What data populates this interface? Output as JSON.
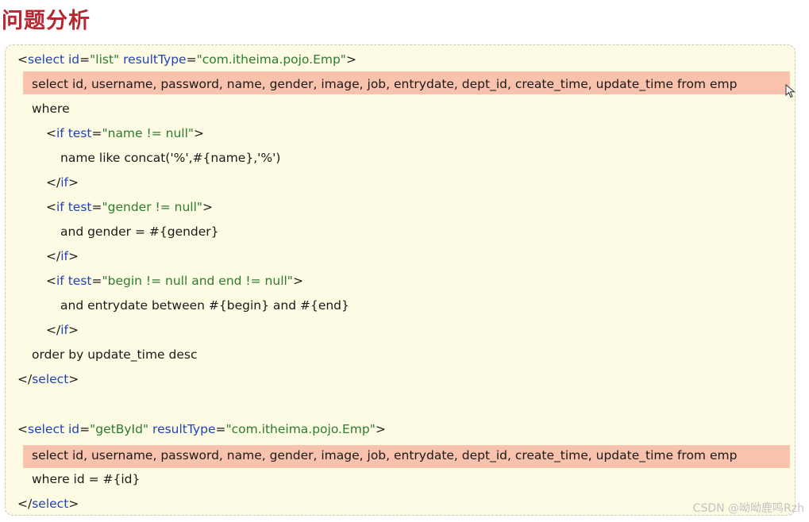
{
  "title": "问题分析",
  "watermark": "CSDN @呦呦鹿鸣Rzh",
  "colors": {
    "title": "#b8262f",
    "box_background": "#fdfbe3",
    "highlight": "#f9c2ac",
    "tag": "#1f43b5",
    "attr_value": "#2c7c2f"
  },
  "select1": {
    "open_lt": "<",
    "tag": "select",
    "attr1_name": "id",
    "attr1_value": "\"list\"",
    "attr2_name": "resultType",
    "attr2_value": "\"com.itheima.pojo.Emp\"",
    "open_gt": ">",
    "columns": "select id, username, password, name, gender, image, job, entrydate, dept_id, create_time, update_time from emp",
    "where": "where",
    "if1_test": "\"name != null\"",
    "if1_body": "name like concat('%',#{name},'%')",
    "if2_test": "\"gender != null\"",
    "if2_body": "and gender = #{gender}",
    "if3_test": "\"begin != null and end != null\"",
    "if3_body": "and entrydate between #{begin} and #{end}",
    "order": "order by update_time desc"
  },
  "select2": {
    "attr1_value": "\"getById\"",
    "attr2_value": "\"com.itheima.pojo.Emp\"",
    "columns": "select id, username, password, name, gender, image, job, entrydate, dept_id, create_time, update_time from emp",
    "where": "where  id = #{id}"
  },
  "tokens": {
    "lt": "<",
    "gt": ">",
    "close_lt": "</",
    "if_tag": "if",
    "test_attr": "test",
    "eq": "=",
    "select_tag": "select",
    "id_attr": "id",
    "result_attr": "resultType"
  }
}
